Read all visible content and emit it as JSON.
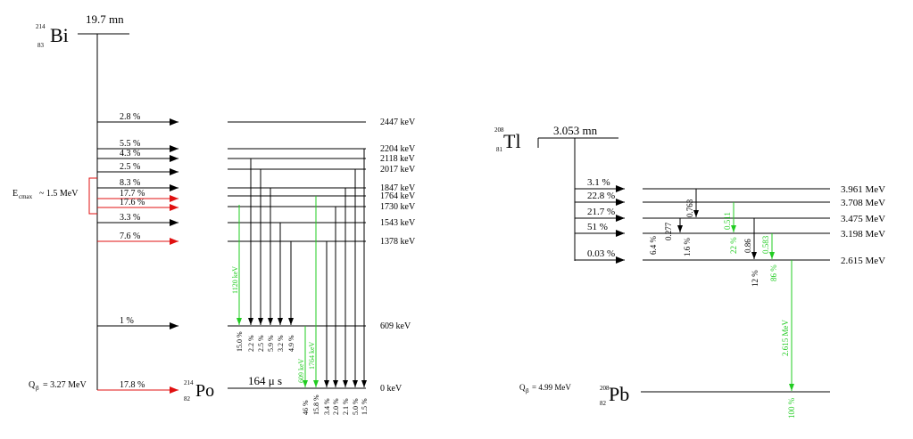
{
  "bi": {
    "mass": "214",
    "z": "83",
    "symbol": "Bi",
    "halflife": "19.7 mn",
    "qbeta_label": "Q",
    "qbeta_sub": "β",
    "qbeta_value": "= 3.27 MeV",
    "ecmax_label": "E",
    "ecmax_sub": "cmax",
    "ecmax_value": "~ 1.5 MeV"
  },
  "po": {
    "mass": "214",
    "z": "82",
    "symbol": "Po",
    "halflife": "164 μ s"
  },
  "bi_branches": [
    {
      "pct": "2.8 %",
      "color": "black"
    },
    {
      "pct": "5.5 %",
      "color": "black"
    },
    {
      "pct": "4.3 %",
      "color": "black"
    },
    {
      "pct": "2.5 %",
      "color": "black"
    },
    {
      "pct": "8.3 %",
      "color": "black"
    },
    {
      "pct": "17.7 %",
      "color": "red"
    },
    {
      "pct": "17.6 %",
      "color": "red"
    },
    {
      "pct": "3.3 %",
      "color": "black"
    },
    {
      "pct": "7.6 %",
      "color": "red"
    },
    {
      "pct": "1 %",
      "color": "black"
    },
    {
      "pct": "17.8 %",
      "color": "red"
    }
  ],
  "po_levels": [
    "2447 keV",
    "2204 keV",
    "2118 keV",
    "2017 keV",
    "1847 keV",
    "1764 keV",
    "1730 keV",
    "1543 keV",
    "1378 keV",
    "609 keV",
    "0 keV"
  ],
  "po_to609_intensities": [
    "15.0 %",
    "2.2 %",
    "2.5 %",
    "5.9 %",
    "3.2 %",
    "4.9 %"
  ],
  "po_to0_intensities": [
    "46 %",
    "15.8 %",
    "3.4 %",
    "2.0 %",
    "2.1 %",
    "5.0 %",
    "1.5 %"
  ],
  "po_gamma_labels": [
    "1120 keV",
    "609 keV",
    "1764 keV"
  ],
  "tl": {
    "mass": "208",
    "z": "81",
    "symbol": "Tl",
    "halflife": "3.053 mn"
  },
  "pb": {
    "mass": "208",
    "z": "82",
    "symbol": "Pb",
    "qbeta_label": "Q",
    "qbeta_sub": "β",
    "qbeta_value": "= 4.99 MeV"
  },
  "tl_branches": [
    "3.1 %",
    "22.8 %",
    "21.7 %",
    "51 %",
    "0.03 %"
  ],
  "pb_levels": [
    "3.961 MeV",
    "3.708 MeV",
    "3.475 MeV",
    "3.198 MeV",
    "2.615 MeV"
  ],
  "pb_gamma_energies": [
    "0.763",
    "0.277",
    "0.511",
    "0.86",
    "0.583",
    "2.615 MeV"
  ],
  "pb_gamma_intensities": [
    "6.4 %",
    "1.6 %",
    "22 %",
    "12 %",
    "86 %",
    "100 %"
  ],
  "colors": {
    "red": "#e01010",
    "green": "#22cc22",
    "black": "#000000"
  }
}
